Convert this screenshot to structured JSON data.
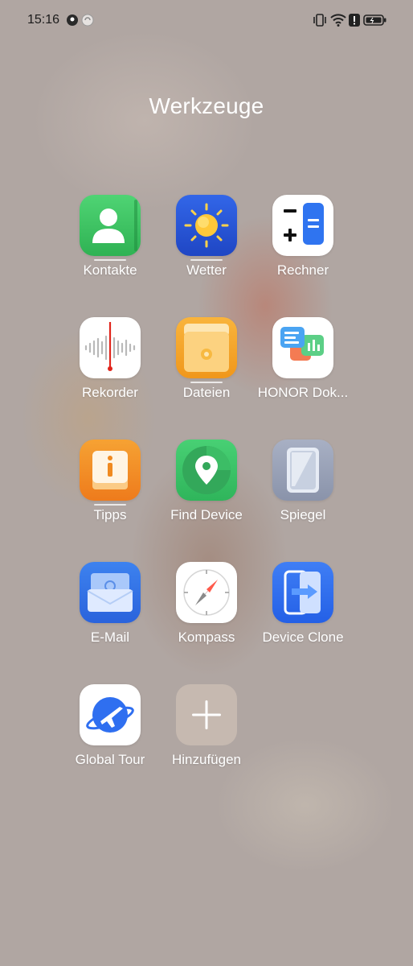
{
  "status_bar": {
    "time": "15:16",
    "icons": [
      "location-icon",
      "sync-icon",
      "vibrate-icon",
      "wifi-icon",
      "alert-icon",
      "battery-icon"
    ]
  },
  "folder": {
    "title": "Werkzeuge"
  },
  "apps": [
    {
      "label": "Kontakte",
      "icon": "contacts-icon",
      "color": "#3cc35e"
    },
    {
      "label": "Wetter",
      "icon": "weather-icon",
      "color": "#2b57d8"
    },
    {
      "label": "Rechner",
      "icon": "calculator-icon",
      "color": "#ffffff"
    },
    {
      "label": "Rekorder",
      "icon": "recorder-icon",
      "color": "#ffffff"
    },
    {
      "label": "Dateien",
      "icon": "files-icon",
      "color": "#f4a21f"
    },
    {
      "label": "HONOR Dok...",
      "icon": "honor-docs-icon",
      "color": "#ffffff"
    },
    {
      "label": "Tipps",
      "icon": "tips-icon",
      "color": "#f28a21"
    },
    {
      "label": "Find Device",
      "icon": "find-device-icon",
      "color": "#3cc35e"
    },
    {
      "label": "Spiegel",
      "icon": "mirror-icon",
      "color": "#9aa3b8"
    },
    {
      "label": "E-Mail",
      "icon": "email-icon",
      "color": "#3273e6"
    },
    {
      "label": "Kompass",
      "icon": "compass-icon",
      "color": "#ffffff"
    },
    {
      "label": "Device Clone",
      "icon": "device-clone-icon",
      "color": "#2f6ff0"
    },
    {
      "label": "Global Tour",
      "icon": "global-tour-icon",
      "color": "#ffffff"
    },
    {
      "label": "Hinzufügen",
      "icon": "add-icon",
      "color": "#c9bdb5"
    }
  ]
}
